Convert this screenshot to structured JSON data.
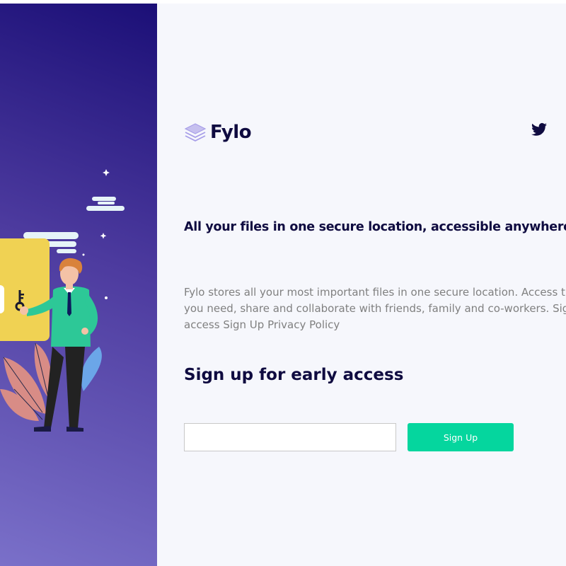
{
  "brand": {
    "logo_icon": "stacked-layers-icon",
    "name": "Fylo"
  },
  "social": {
    "icon": "twitter-icon"
  },
  "hero": {
    "headline": "All your files in one secure location, accessible anywhere.",
    "description_lines": [
      "Fylo stores all your most important files in one secure location. Access th",
      "you need, share and collaborate with friends, family and co-workers. Sign",
      "access Sign Up Privacy Policy"
    ]
  },
  "signup": {
    "heading": "Sign up for early access",
    "email_value": "",
    "email_placeholder": "",
    "button_label": "Sign Up"
  },
  "colors": {
    "brand_dark": "#0f0b40",
    "accent": "#05d69e",
    "gradient_top": "#1b0f77",
    "gradient_bottom": "#7a70c9",
    "body_text": "#808080",
    "background": "#f6f7fc"
  }
}
